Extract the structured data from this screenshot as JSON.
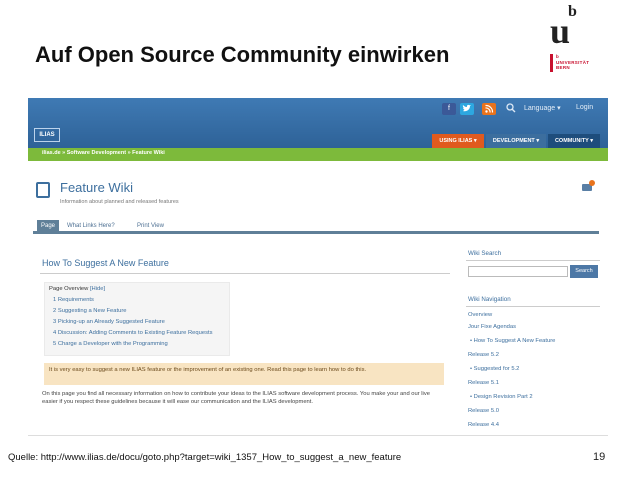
{
  "slide": {
    "title": "Auf Open Source Community einwirken",
    "logo_mark": "u",
    "logo_sup": "b",
    "logo_text": "b\nUNIVERSITÄT\nBERN",
    "source": "Quelle: http://www.ilias.de/docu/goto.php?target=wiki_1357_How_to_suggest_a_new_feature",
    "page_number": "19"
  },
  "site": {
    "logo": "ILIAS",
    "facebook_icon": "f",
    "twitter_icon": "t",
    "rss_icon": "rss",
    "search_icon": "search-icon",
    "language": "Language ▾",
    "login": "Login",
    "nav": {
      "using": "USING ILIAS ▾",
      "development": "DEVELOPMENT ▾",
      "community": "COMMUNITY ▾"
    },
    "breadcrumb": "ilias.de  »  Software Development  »  Feature Wiki",
    "colors": {
      "topbar": "#2c5f94",
      "crumbbar": "#7dba3b",
      "accent": "#e05a1e"
    }
  },
  "wiki": {
    "title": "Feature Wiki",
    "subtitle": "Information about planned and released features",
    "tabs": {
      "page": "Page",
      "links": "What Links Here?",
      "print": "Print View"
    },
    "heading": "How To Suggest A New Feature",
    "overview": {
      "title": "Page Overview",
      "hide": "[Hide]",
      "items": [
        "1 Requirements",
        "2 Suggesting a New Feature",
        "3 Picking-up an Already Suggested Feature",
        "4 Discussion: Adding Comments to Existing Feature Requests",
        "5 Charge a Developer with the Programming"
      ]
    },
    "notice": "It is very easy to suggest a new ILIAS feature or the improvement of an existing one. Read this page to learn how to do this.",
    "body": "On this page you find all necessary information on how to contribute your ideas to the ILIAS software development process. You make your and our live easier if you respect these guidelines because it will ease our communication and the ILIAS development."
  },
  "sidebar": {
    "search_title": "Wiki Search",
    "search_button": "Search",
    "nav_title": "Wiki Navigation",
    "links": [
      "Overview",
      "Jour Fixe Agendas",
      "• How To Suggest A New Feature",
      "Release 5.2",
      "• Suggested for 5.2",
      "Release 5.1",
      "• Design Revision Part 2",
      "Release 5.0",
      "Release 4.4"
    ]
  }
}
